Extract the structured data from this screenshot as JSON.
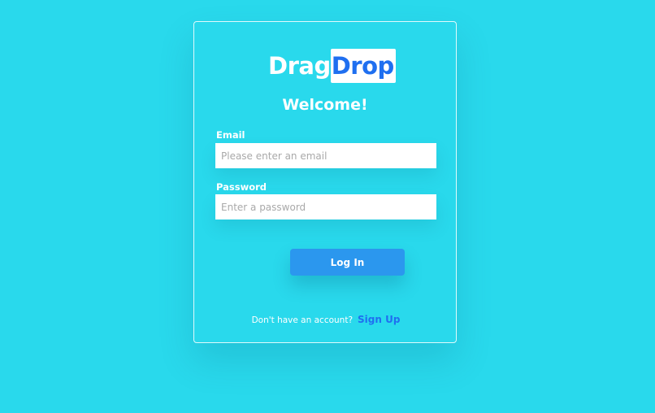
{
  "brand": {
    "part1": "Drag",
    "part2": "Drop"
  },
  "heading": "Welcome!",
  "email": {
    "label": "Email",
    "placeholder": "Please enter an email",
    "value": ""
  },
  "password": {
    "label": "Password",
    "placeholder": "Enter a password",
    "value": ""
  },
  "login_button": "Log In",
  "signup": {
    "prompt": "Don't have an account?",
    "link": "Sign Up"
  },
  "colors": {
    "background": "#29d9ec",
    "brand_blue": "#1f6ff0",
    "button_blue": "#2b97ee",
    "white": "#ffffff"
  }
}
